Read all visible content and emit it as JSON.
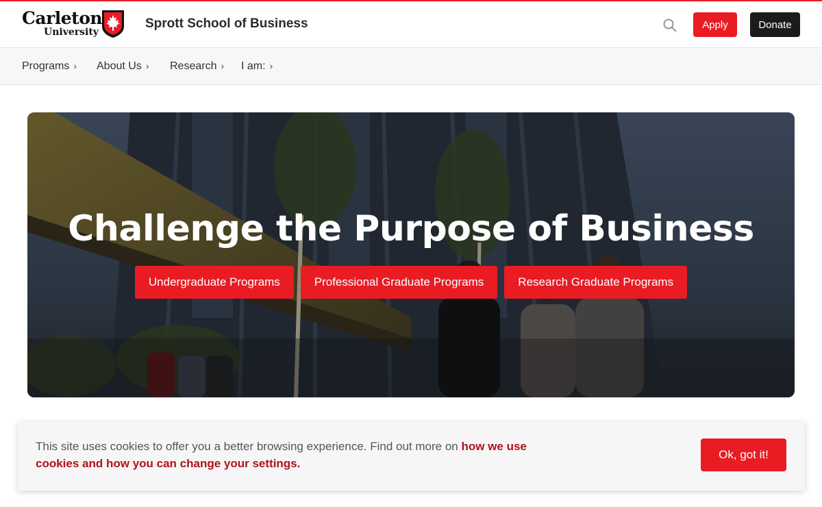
{
  "brand": {
    "logo_line1": "Carleton",
    "logo_line2": "University",
    "school_name": "Sprott School of Business",
    "accent_color": "#e91c24"
  },
  "header": {
    "search_icon": "search-icon",
    "apply_label": "Apply",
    "donate_label": "Donate"
  },
  "nav": {
    "items": [
      {
        "label": "Programs"
      },
      {
        "label": "About Us"
      },
      {
        "label": "Research"
      },
      {
        "label": "I am:"
      }
    ],
    "chevron": "›"
  },
  "hero": {
    "title": "Challenge the Purpose of Business",
    "buttons": [
      {
        "label": "Undergraduate Programs"
      },
      {
        "label": "Professional Graduate Programs"
      },
      {
        "label": "Research Graduate Programs"
      }
    ]
  },
  "cookie": {
    "text": "This site uses cookies to offer you a better browsing experience. Find out more on ",
    "link_text": "how we use cookies and how you can change your settings.",
    "ok_label": "Ok, got it!"
  }
}
